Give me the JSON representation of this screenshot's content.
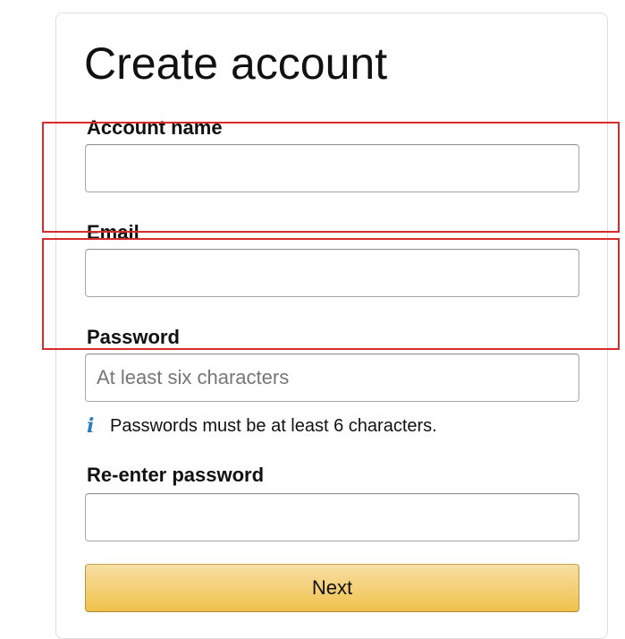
{
  "page_title": "Create account",
  "form": {
    "account_name": {
      "label": "Account name",
      "value": "",
      "placeholder": ""
    },
    "email": {
      "label": "Email",
      "value": "",
      "placeholder": ""
    },
    "password": {
      "label": "Password",
      "value": "",
      "placeholder": "At least six characters",
      "hint_icon": "i",
      "hint": "Passwords must be at least 6 characters."
    },
    "reenter_password": {
      "label": "Re-enter password",
      "value": "",
      "placeholder": ""
    },
    "next_label": "Next"
  },
  "colors": {
    "button_gradient_top": "#f7dfa5",
    "button_gradient_bottom": "#f0c14b",
    "info_icon": "#2b7fb8",
    "highlight": "#d92b2b"
  },
  "icons": {
    "hint": "info-icon"
  }
}
